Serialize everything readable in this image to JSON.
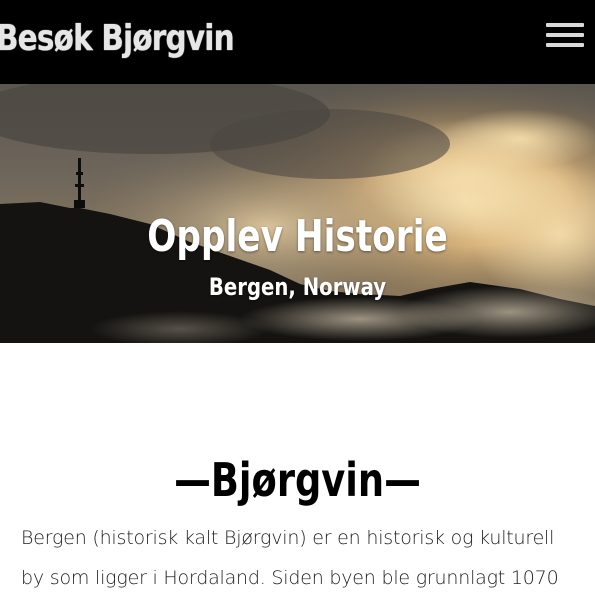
{
  "header": {
    "brand": "Besøk Bjørgvin",
    "menu_icon": "hamburger-menu-icon",
    "background": "#000000"
  },
  "hero": {
    "title": "Opplev Historie",
    "subtitle": "Bergen, Norway",
    "image": "mountain-silhouette-with-radio-tower-and-golden-clouds"
  },
  "main": {
    "heading": "—Bjørgvin—",
    "intro_line1": "Bergen (historisk kalt Bjørgvin) er en historisk og kulturell",
    "intro_line2": "by som ligger i Hordaland. Siden byen ble grunnlagt  1070"
  }
}
